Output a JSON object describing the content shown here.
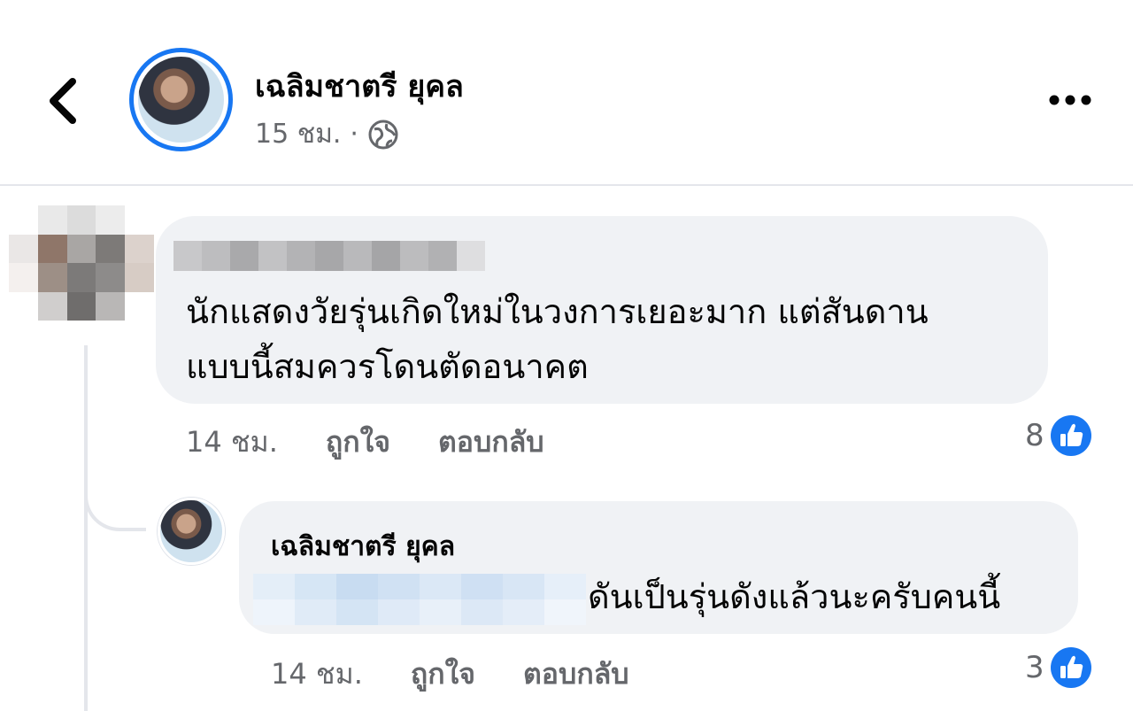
{
  "post": {
    "author_name": "เฉลิมชาตรี ยุคล",
    "time": "15 ชม.",
    "separator": "·",
    "privacy_icon": "globe-icon"
  },
  "nav": {
    "back_icon": "chevron-left-icon",
    "more_icon": "more-horizontal-icon"
  },
  "comments": [
    {
      "author_name_hidden": true,
      "text_line1": "นักแสดงวัยรุ่นเกิดใหม่ในวงการเยอะมาก แต่สันดาน",
      "text_line2": "แบบนี้สมควรโดนตัดอนาคต",
      "time": "14 ชม.",
      "like_label": "ถูกใจ",
      "reply_label": "ตอบกลับ",
      "reaction_count": "8",
      "reaction_icon": "like-icon"
    }
  ],
  "reply": {
    "author_name": "เฉลิมชาตรี ยุคล",
    "text": "ดันเป็นรุ่นดังแล้วนะครับคนนี้",
    "time": "14 ชม.",
    "like_label": "ถูกใจ",
    "reply_label": "ตอบกลับ",
    "reaction_count": "3",
    "reaction_icon": "like-icon"
  },
  "colors": {
    "accent": "#1877f2",
    "bubble": "#f0f2f5",
    "secondary_text": "#65676b"
  }
}
